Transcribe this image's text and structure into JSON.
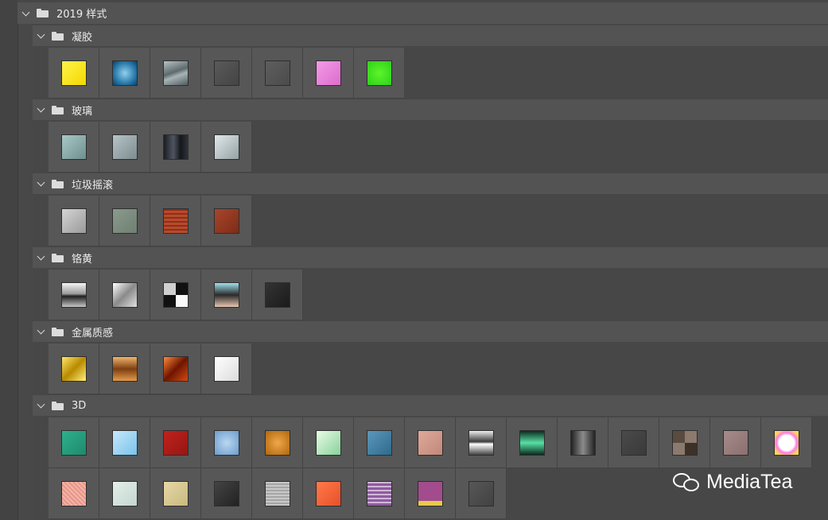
{
  "root": {
    "title": "2019 样式"
  },
  "groups": [
    {
      "title": "凝胶",
      "swatches": [
        {
          "bg": "linear-gradient(135deg,#fff34a,#f2d800)"
        },
        {
          "bg": "radial-gradient(circle,#8fd0ee,#1e6ea0 70%,#0d3f66)"
        },
        {
          "bg": "linear-gradient(160deg,#b9c2c4,#5d6a6e 45%,#a7b3b5 60%,#4f5b5e)"
        },
        {
          "bg": "linear-gradient(135deg,#5a5a5a,#444)"
        },
        {
          "bg": "linear-gradient(135deg,#5e5e5e,#4b4b4b)"
        },
        {
          "bg": "linear-gradient(135deg,#f49be6,#dc6ccd)"
        },
        {
          "bg": "radial-gradient(circle,#5cf52a,#2ed01a)"
        }
      ]
    },
    {
      "title": "玻璃",
      "swatches": [
        {
          "bg": "linear-gradient(135deg,#a9c8c8,#6f8f8f)"
        },
        {
          "bg": "linear-gradient(135deg,#b7c4c7,#7c8c8f)"
        },
        {
          "bg": "linear-gradient(90deg,#1a1d22,#4f5560 40%,#14161a 70%,#2e333a)"
        },
        {
          "bg": "linear-gradient(135deg,#e1e8ea,#95a2a6)"
        }
      ]
    },
    {
      "title": "垃圾摇滚",
      "swatches": [
        {
          "bg": "linear-gradient(135deg,#d4d4d4,#9a9a9a)"
        },
        {
          "bg": "linear-gradient(135deg,#8a9a8c,#6f7f71)"
        },
        {
          "bg": "repeating-linear-gradient(0deg,#b84a2c 0 3px,#8d2f1a 3px 5px)"
        },
        {
          "bg": "linear-gradient(135deg,#a8452c,#7d2c18)"
        }
      ]
    },
    {
      "title": "铬黄",
      "swatches": [
        {
          "bg": "linear-gradient(180deg,#f4f4f4,#9b9b9b 45%,#1f1f1f 55%,#c7c7c7)"
        },
        {
          "bg": "linear-gradient(135deg,#ffffff,#8a8a8a 50%,#e0e0e0)"
        },
        {
          "bg": "conic-gradient(#111 0 25%,#fafafa 25% 50%,#111 50% 75%,#cfcfcf 75%)"
        },
        {
          "bg": "linear-gradient(180deg,#9fe0ec,#2a2a2a 50%,#e8c6b0)"
        },
        {
          "bg": "linear-gradient(135deg,#333,#1b1b1b)"
        }
      ]
    },
    {
      "title": "金属质感",
      "swatches": [
        {
          "bg": "linear-gradient(135deg,#ffe66a,#b98a00 50%,#fff07c)"
        },
        {
          "bg": "linear-gradient(180deg,#f1b36a,#7d3f10 50%,#e39a4c)"
        },
        {
          "bg": "linear-gradient(135deg,#ff8a3a,#6e1500 50%,#d44a12)"
        },
        {
          "bg": "linear-gradient(135deg,#ffffff,#dcdcdc)"
        }
      ]
    },
    {
      "title": "3D",
      "swatches": [
        {
          "bg": "linear-gradient(135deg,#2fb08e,#1e8a6c)"
        },
        {
          "bg": "linear-gradient(135deg,#c6e8fb,#7ac2ea)"
        },
        {
          "bg": "linear-gradient(135deg,#c2221d,#941613)"
        },
        {
          "bg": "radial-gradient(circle,#b9d7f1,#6c9ccc)"
        },
        {
          "bg": "radial-gradient(circle,#f0a64a,#b0680c)"
        },
        {
          "bg": "linear-gradient(135deg,#e9fbe6,#87d29a)"
        },
        {
          "bg": "linear-gradient(135deg,#5b98bb,#2f6a8c)"
        },
        {
          "bg": "linear-gradient(135deg,#e0a99a,#c0887a)"
        },
        {
          "bg": "linear-gradient(180deg,#eee,#3a3a3a 45%,#fff 55%,#444)"
        },
        {
          "bg": "linear-gradient(180deg,#0c2a1f,#57e0a4 50%,#0c2a1f)"
        },
        {
          "bg": "linear-gradient(90deg,#222,#8c8c8c 50%,#222)"
        },
        {
          "bg": "linear-gradient(135deg,#4a4a4a,#3a3a3a)"
        },
        {
          "bg": "conic-gradient(#8b7a6d 0 25%,#3b3129 25% 50%,#8b7a6d 50% 75%,#5a4b40 75%)"
        },
        {
          "bg": "linear-gradient(135deg,#a58c89,#8b6f70)"
        },
        {
          "bg": "radial-gradient(circle,#ffffff 45%,#ff7ae0 60%,#ffd65a 80%)"
        },
        {
          "bg": "repeating-linear-gradient(45deg,#f3b4aa 0 2px,#e69687 2px 4px)"
        },
        {
          "bg": "linear-gradient(135deg,#e4efea,#c3d6cf)"
        },
        {
          "bg": "linear-gradient(135deg,#e6d8a6,#c9b97e)"
        },
        {
          "bg": "linear-gradient(135deg,#444,#222)"
        },
        {
          "bg": "repeating-linear-gradient(0deg,#c8c8c8 0 2px,#a5a5a5 2px 4px)"
        },
        {
          "bg": "linear-gradient(135deg,#ff7a4a,#e8502a)"
        },
        {
          "bg": "repeating-linear-gradient(0deg,#8e5c9e 0 3px,#d2b6da 3px 5px)"
        },
        {
          "bg": "linear-gradient(180deg,#a24c8e 80%,#e8c94a 80%)"
        },
        {
          "bg": "linear-gradient(135deg,#575757,#424242)"
        }
      ]
    }
  ],
  "watermark": {
    "text": "MediaTea",
    "icon": "wechat-icon"
  }
}
